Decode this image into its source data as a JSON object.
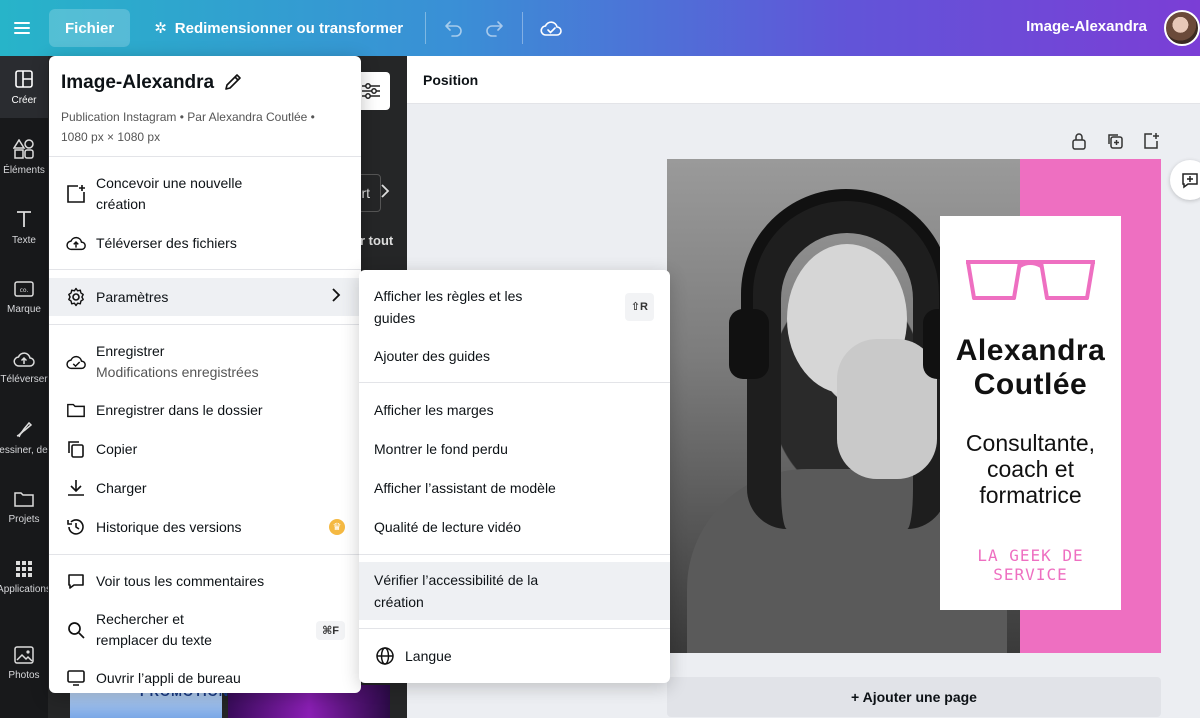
{
  "topbar": {
    "menu_icon": "hamburger-icon",
    "file_label": "Fichier",
    "resize_label": "Redimensionner ou transformer",
    "undo_icon": "undo-icon",
    "redo_icon": "redo-icon",
    "cloud_icon": "cloud-saved-icon",
    "document_title": "Image-Alexandra"
  },
  "rail": [
    {
      "label": "Créer",
      "icon": "layout-icon"
    },
    {
      "label": "Éléments",
      "icon": "shapes-icon"
    },
    {
      "label": "Texte",
      "icon": "text-icon"
    },
    {
      "label": "Marque",
      "icon": "brand-icon"
    },
    {
      "label": "Téléverser",
      "icon": "upload-icon"
    },
    {
      "label": "Dessiner, de...",
      "icon": "draw-icon"
    },
    {
      "label": "Projets",
      "icon": "folder-icon"
    },
    {
      "label": "Applications",
      "icon": "apps-icon"
    },
    {
      "label": "Photos",
      "icon": "photo-icon"
    }
  ],
  "side_panel": {
    "pill_text": "rt",
    "see_all": "r tout",
    "promo_text": "PROMOTION"
  },
  "context_bar": {
    "position_label": "Position"
  },
  "design": {
    "name_line1": "Alexandra",
    "name_line2": "Coutlée",
    "role_line1": "Consultante,",
    "role_line2": "coach et",
    "role_line3": "formatrice",
    "tagline": "LA GEEK DE SERVICE",
    "accent_color": "#ee6fc1"
  },
  "add_page_label": "+ Ajouter une page",
  "file_menu": {
    "title": "Image-Alexandra",
    "meta_line1": "Publication Instagram • Par Alexandra Coutlée •",
    "meta_line2": "1080 px × 1080 px",
    "items": {
      "new_design_1": "Concevoir une nouvelle",
      "new_design_2": "création",
      "upload": "Téléverser des fichiers",
      "settings": "Paramètres",
      "save": "Enregistrer",
      "save_status": "Modifications enregistrées",
      "save_folder": "Enregistrer dans le dossier",
      "copy": "Copier",
      "download": "Charger",
      "history": "Historique des versions",
      "comments": "Voir tous les commentaires",
      "find_1": "Rechercher et",
      "find_2": "remplacer du texte",
      "find_kbd": "⌘F",
      "desktop_app": "Ouvrir l’appli de bureau"
    }
  },
  "settings_menu": {
    "rulers_1": "Afficher les règles et les",
    "rulers_2": "guides",
    "rulers_kbd": "⇧R",
    "add_guides": "Ajouter des guides",
    "margins": "Afficher les marges",
    "bleed": "Montrer le fond perdu",
    "template_assist": "Afficher l’assistant de modèle",
    "video_quality": "Qualité de lecture vidéo",
    "accessibility_1": "Vérifier l’accessibilité de la",
    "accessibility_2": "création",
    "language": "Langue"
  }
}
